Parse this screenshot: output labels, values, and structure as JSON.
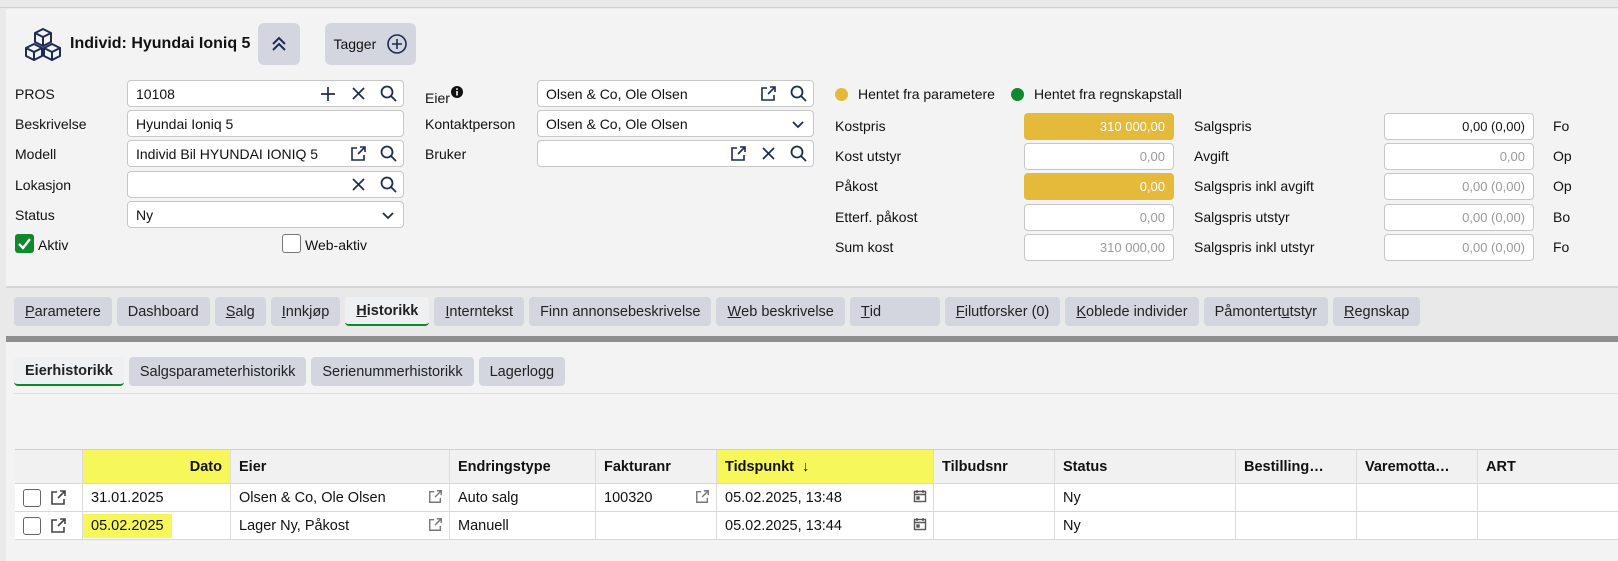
{
  "header": {
    "title": "Individ: Hyundai Ioniq 5",
    "tag_label": "Tagger"
  },
  "form": {
    "pros_label": "PROS",
    "pros_value": "10108",
    "beskrivelse_label": "Beskrivelse",
    "beskrivelse_value": "Hyundai Ioniq 5",
    "modell_label": "Modell",
    "modell_value": "Individ Bil HYUNDAI IONIQ 5",
    "lokasjon_label": "Lokasjon",
    "lokasjon_value": "",
    "status_label": "Status",
    "status_value": "Ny",
    "aktiv_label": "Aktiv",
    "webaktiv_label": "Web-aktiv",
    "eier_label": "Eier",
    "eier_value": "Olsen  & Co, Ole Olsen",
    "kontakt_label": "Kontaktperson",
    "kontakt_value": "Olsen & Co, Ole Olsen",
    "bruker_label": "Bruker",
    "bruker_value": ""
  },
  "legend": {
    "param_label": "Hentet fra parametere",
    "param_color": "#e5b93a",
    "regnskap_label": "Hentet fra regnskapstall",
    "regnskap_color": "#0e8a2b"
  },
  "costs": {
    "kostpris_label": "Kostpris",
    "kostpris_value": "310 000,00",
    "kostutstyr_label": "Kost utstyr",
    "kostutstyr_value": "0,00",
    "pakost_label": "Påkost",
    "pakost_value": "0,00",
    "etterf_label": "Etterf. påkost",
    "etterf_value": "0,00",
    "sumkost_label": "Sum kost",
    "sumkost_value": "310 000,00"
  },
  "sales": {
    "salgspris_label": "Salgspris",
    "salgspris_value": "0,00 (0,00)",
    "avgift_label": "Avgift",
    "avgift_value": "0,00",
    "inklavgift_label": "Salgspris inkl avgift",
    "inklavgift_value": "0,00 (0,00)",
    "utstyr_label": "Salgspris utstyr",
    "utstyr_value": "0,00 (0,00)",
    "inklutstyr_label": "Salgspris inkl utstyr",
    "inklutstyr_value": "0,00 (0,00)"
  },
  "edge_labels": [
    "Fo",
    "Op",
    "Op",
    "Bo",
    "Fo"
  ],
  "tabs": [
    {
      "pre": "",
      "u": "P",
      "post": "arametere"
    },
    {
      "pre": "Dashboard",
      "u": "",
      "post": ""
    },
    {
      "pre": "",
      "u": "S",
      "post": "alg"
    },
    {
      "pre": "",
      "u": "I",
      "post": "nnkjøp"
    },
    {
      "pre": "",
      "u": "H",
      "post": "istorikk"
    },
    {
      "pre": "",
      "u": "I",
      "post": "nterntekst"
    },
    {
      "pre": "Finn annonsebeskrivelse",
      "u": "",
      "post": ""
    },
    {
      "pre": "",
      "u": "W",
      "post": "eb beskrivelse"
    },
    {
      "pre": "",
      "u": "T",
      "post": "id"
    },
    {
      "pre": "",
      "u": "F",
      "post": "ilutforsker (0)"
    },
    {
      "pre": "",
      "u": "K",
      "post": "oblede individer"
    },
    {
      "pre": "Påmontert ",
      "u": "u",
      "post": "tstyr"
    },
    {
      "pre": "",
      "u": "R",
      "post": "egnskap"
    }
  ],
  "subtabs": [
    "Eierhistorikk",
    "Salgsparameterhistorikk",
    "Serienummerhistorikk",
    "Lagerlogg"
  ],
  "table": {
    "columns": [
      "Dato",
      "Eier",
      "Endringstype",
      "Fakturanr",
      "Tidspunkt",
      "Tilbudsnr",
      "Status",
      "Bestilling…",
      "Varemotta…",
      "ART"
    ],
    "sort_arrow": "↓",
    "rows": [
      {
        "dato": "31.01.2025",
        "eier": "Olsen & Co, Ole Olsen",
        "endring": "Auto salg",
        "faktura": "100320",
        "tidspunkt": "05.02.2025, 13:48",
        "tilbud": "",
        "status": "Ny"
      },
      {
        "dato": "05.02.2025",
        "eier": "Lager Ny, Påkost",
        "endring": "Manuell",
        "faktura": "",
        "tidspunkt": "05.02.2025, 13:44",
        "tilbud": "",
        "status": "Ny"
      }
    ]
  }
}
